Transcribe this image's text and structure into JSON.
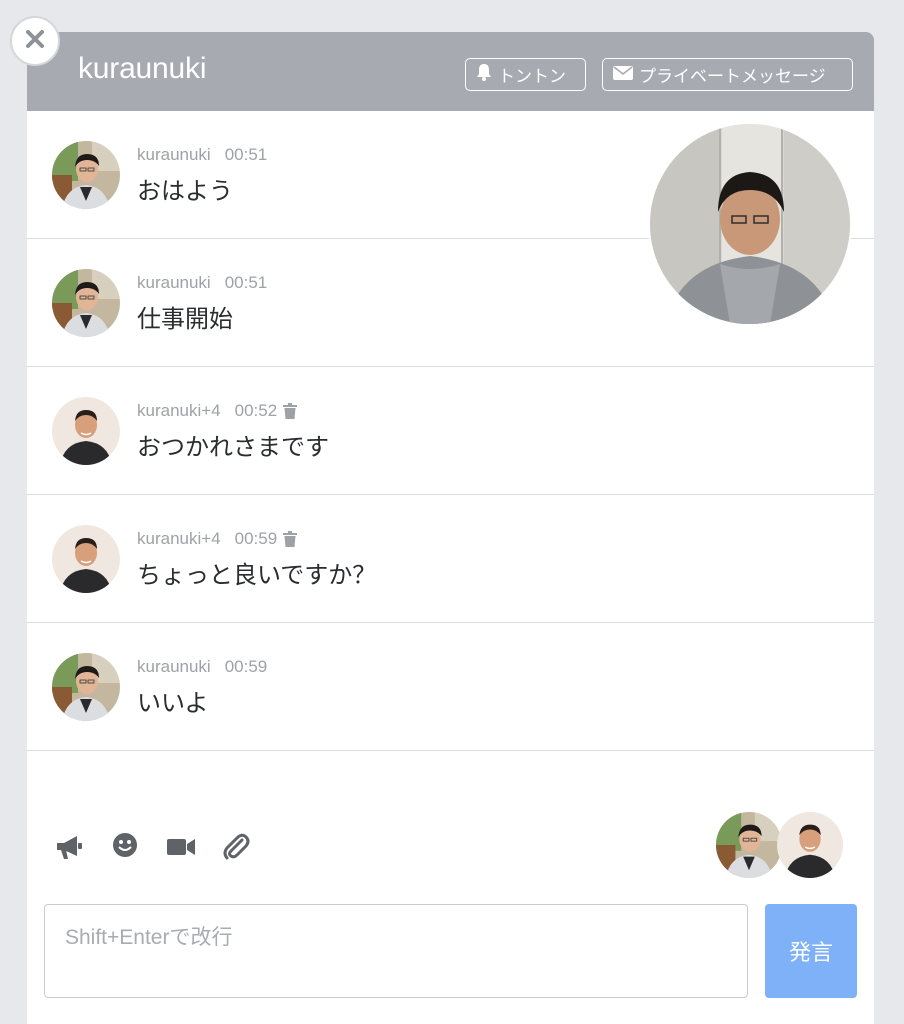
{
  "header": {
    "title": "kuraunuki",
    "knock_label": "トントン",
    "pm_label": "プライベートメッセージ",
    "close_icon": "close-icon",
    "bg_color": "#a7abb1"
  },
  "messages": [
    {
      "user": "kuraunuki",
      "time": "00:51",
      "text": "おはよう",
      "deletable": false,
      "avatar": "avatar-kuraunuki"
    },
    {
      "user": "kuraunuki",
      "time": "00:51",
      "text": "仕事開始",
      "deletable": false,
      "avatar": "avatar-kuraunuki"
    },
    {
      "user": "kuranuki+4",
      "time": "00:52",
      "text": "おつかれさまです",
      "deletable": true,
      "avatar": "avatar-kuranuki4"
    },
    {
      "user": "kuranuki+4",
      "time": "00:59",
      "text": "ちょっと良いですか？",
      "deletable": true,
      "avatar": "avatar-kuranuki4"
    },
    {
      "user": "kuraunuki",
      "time": "00:59",
      "text": "いいよ",
      "deletable": false,
      "avatar": "avatar-kuraunuki"
    }
  ],
  "toolbar": {
    "icons": [
      "megaphone-icon",
      "smiley-icon",
      "video-camera-icon",
      "paperclip-icon"
    ]
  },
  "composer": {
    "placeholder": "Shift+Enterで改行",
    "value": "",
    "send_label": "発言",
    "send_color": "#7eb1f7"
  }
}
